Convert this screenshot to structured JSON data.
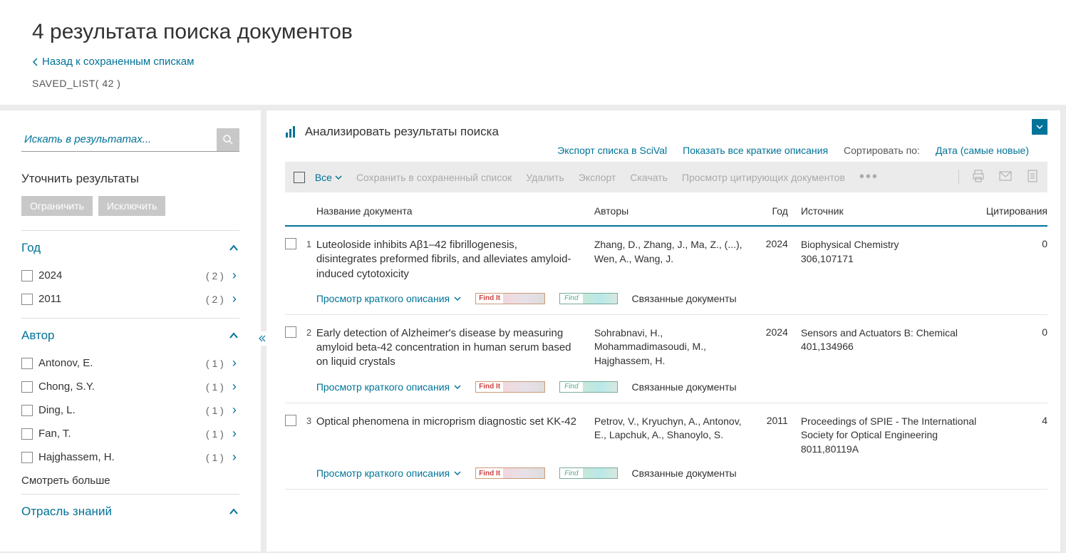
{
  "header": {
    "title": "4 результата поиска документов",
    "back_label": "Назад к сохраненным спискам",
    "saved_label": "SAVED_LIST( 42 )"
  },
  "sidebar": {
    "search_placeholder": "Искать в результатах...",
    "refine_title": "Уточнить результаты",
    "limit_btn": "Ограничить",
    "exclude_btn": "Исключить",
    "show_more": "Смотреть больше",
    "facets": [
      {
        "title": "Год",
        "items": [
          {
            "label": "2024",
            "count": "( 2 )"
          },
          {
            "label": "2011",
            "count": "( 2 )"
          }
        ]
      },
      {
        "title": "Автор",
        "items": [
          {
            "label": "Antonov, E.",
            "count": "( 1 )"
          },
          {
            "label": "Chong, S.Y.",
            "count": "( 1 )"
          },
          {
            "label": "Ding, L.",
            "count": "( 1 )"
          },
          {
            "label": "Fan, T.",
            "count": "( 1 )"
          },
          {
            "label": "Hajghassem, H.",
            "count": "( 1 )"
          }
        ]
      },
      {
        "title": "Отрасль знаний",
        "items": []
      }
    ]
  },
  "results": {
    "analyze_label": "Анализировать результаты поиска",
    "export_scival": "Экспорт списка в SciVal",
    "show_abstracts": "Показать все краткие описания",
    "sort_label": "Сортировать по:",
    "sort_value": "Дата (самые новые)",
    "actions": {
      "all": "Все",
      "save": "Сохранить в сохраненный список",
      "delete": "Удалить",
      "export": "Экспорт",
      "download": "Скачать",
      "view_citing": "Просмотр цитирующих документов"
    },
    "columns": {
      "title": "Название документа",
      "authors": "Авторы",
      "year": "Год",
      "source": "Источник",
      "citations": "Цитирования"
    },
    "row_labels": {
      "view_abstract": "Просмотр краткого описания",
      "related": "Связанные документы",
      "findit": "Find It",
      "find2": "Find"
    },
    "rows": [
      {
        "num": "1",
        "title": "Luteoloside inhibits Aβ1–42 fibrillogenesis, disintegrates preformed fibrils, and alleviates amyloid-induced cytotoxicity",
        "authors": "Zhang, D., Zhang, J., Ma, Z., (...), Wen, A., Wang, J.",
        "year": "2024",
        "source": "Biophysical Chemistry\n306,107171",
        "citations": "0"
      },
      {
        "num": "2",
        "title": "Early detection of Alzheimer's disease by measuring amyloid beta-42 concentration in human serum based on liquid crystals",
        "authors": "Sohrabnavi, H., Mohammadimasoudi, M., Hajghassem, H.",
        "year": "2024",
        "source": "Sensors and Actuators B: Chemical\n401,134966",
        "citations": "0"
      },
      {
        "num": "3",
        "title": "Optical phenomena in microprism diagnostic set KK-42",
        "authors": "Petrov, V., Kryuchyn, A., Antonov, E., Lapchuk, A., Shanoylo, S.",
        "year": "2011",
        "source": "Proceedings of SPIE - The International Society for Optical Engineering\n8011,80119A",
        "citations": "4"
      }
    ]
  }
}
